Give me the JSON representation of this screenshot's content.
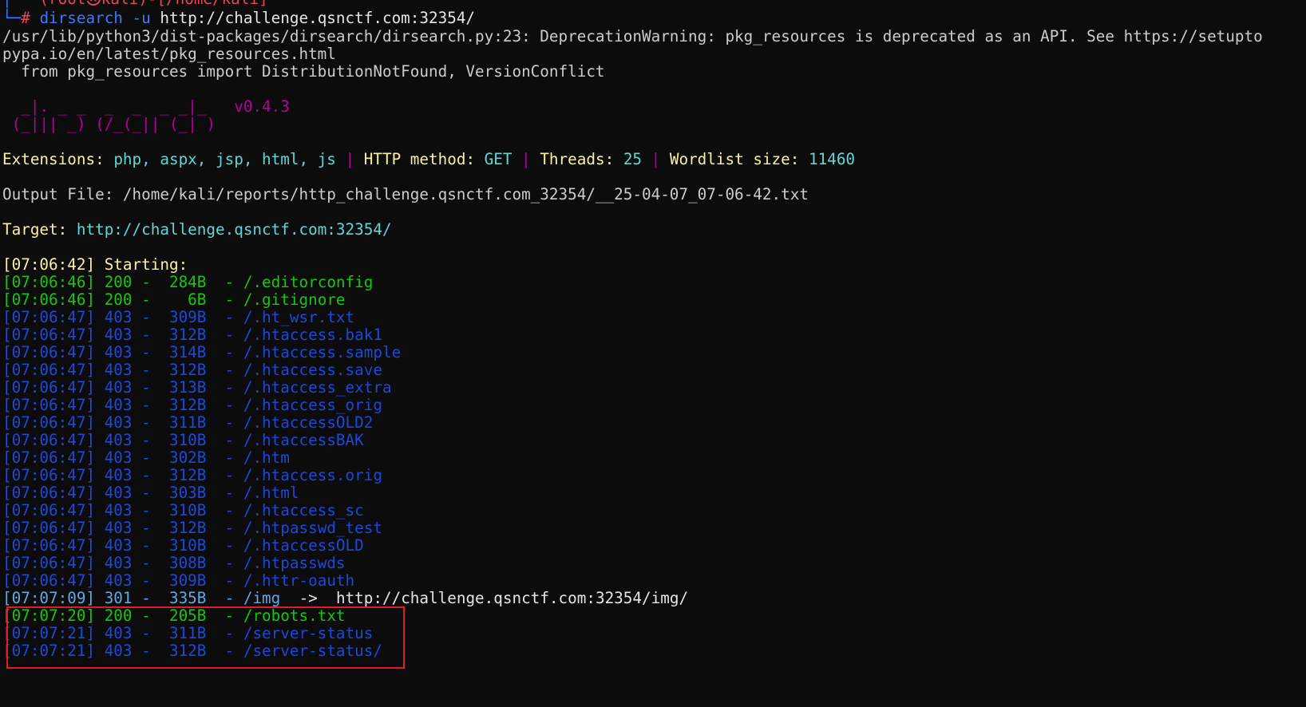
{
  "prompt": {
    "frame_top": "└─",
    "hash": "#",
    "root_fragment": "─(root㉿kali)-[/home/kali]",
    "command": "dirsearch",
    "flag": "-u",
    "url": "http://challenge.qsnctf.com:32354/"
  },
  "warning": {
    "line1": "/usr/lib/python3/dist-packages/dirsearch/dirsearch.py:23: DeprecationWarning: pkg_resources is deprecated as an API. See https://setupto",
    "line2": "pypa.io/en/latest/pkg_resources.html",
    "line3": "  from pkg_resources import DistributionNotFound, VersionConflict"
  },
  "banner": {
    "art1": "  _|. _ _  _  _  _ _|_   ",
    "art2": " (_||| _) (/_(_|| (_| )  ",
    "version": "v0.4.3"
  },
  "config": {
    "ext_label": "Extensions:",
    "ext_value": "php, aspx, jsp, html, js",
    "sep": "|",
    "method_label": "HTTP method:",
    "method_value": "GET",
    "threads_label": "Threads:",
    "threads_value": "25",
    "wordlist_label": "Wordlist size:",
    "wordlist_value": "11460"
  },
  "output_file": "Output File: /home/kali/reports/http_challenge.qsnctf.com_32354/__25-04-07_07-06-42.txt",
  "target": {
    "label": "Target:",
    "url": "http://challenge.qsnctf.com:32354/"
  },
  "start": {
    "time": "[07:06:42]",
    "label": "Starting:"
  },
  "results": [
    {
      "time": "[07:06:46]",
      "code": "200",
      "size": "284B",
      "path": "/.editorconfig",
      "color": "#16c60c"
    },
    {
      "time": "[07:06:46]",
      "code": "200",
      "size": "6B",
      "path": "/.gitignore",
      "color": "#16c60c"
    },
    {
      "time": "[07:06:47]",
      "code": "403",
      "size": "309B",
      "path": "/.ht_wsr.txt",
      "color": "#1f48d9"
    },
    {
      "time": "[07:06:47]",
      "code": "403",
      "size": "312B",
      "path": "/.htaccess.bak1",
      "color": "#1f48d9"
    },
    {
      "time": "[07:06:47]",
      "code": "403",
      "size": "314B",
      "path": "/.htaccess.sample",
      "color": "#1f48d9"
    },
    {
      "time": "[07:06:47]",
      "code": "403",
      "size": "312B",
      "path": "/.htaccess.save",
      "color": "#1f48d9"
    },
    {
      "time": "[07:06:47]",
      "code": "403",
      "size": "313B",
      "path": "/.htaccess_extra",
      "color": "#1f48d9"
    },
    {
      "time": "[07:06:47]",
      "code": "403",
      "size": "312B",
      "path": "/.htaccess_orig",
      "color": "#1f48d9"
    },
    {
      "time": "[07:06:47]",
      "code": "403",
      "size": "311B",
      "path": "/.htaccessOLD2",
      "color": "#1f48d9"
    },
    {
      "time": "[07:06:47]",
      "code": "403",
      "size": "310B",
      "path": "/.htaccessBAK",
      "color": "#1f48d9"
    },
    {
      "time": "[07:06:47]",
      "code": "403",
      "size": "302B",
      "path": "/.htm",
      "color": "#1f48d9"
    },
    {
      "time": "[07:06:47]",
      "code": "403",
      "size": "312B",
      "path": "/.htaccess.orig",
      "color": "#1f48d9"
    },
    {
      "time": "[07:06:47]",
      "code": "403",
      "size": "303B",
      "path": "/.html",
      "color": "#1f48d9"
    },
    {
      "time": "[07:06:47]",
      "code": "403",
      "size": "310B",
      "path": "/.htaccess_sc",
      "color": "#1f48d9"
    },
    {
      "time": "[07:06:47]",
      "code": "403",
      "size": "312B",
      "path": "/.htpasswd_test",
      "color": "#1f48d9"
    },
    {
      "time": "[07:06:47]",
      "code": "403",
      "size": "310B",
      "path": "/.htaccessOLD",
      "color": "#1f48d9"
    },
    {
      "time": "[07:06:47]",
      "code": "403",
      "size": "308B",
      "path": "/.htpasswds",
      "color": "#1f48d9"
    },
    {
      "time": "[07:06:47]",
      "code": "403",
      "size": "309B",
      "path": "/.httr-oauth",
      "color": "#1f48d9"
    },
    {
      "time": "[07:07:09]",
      "code": "301",
      "size": "335B",
      "path": "/img",
      "redirect": "http://challenge.qsnctf.com:32354/img/",
      "color": "#61a8e6"
    },
    {
      "time": "[07:07:20]",
      "code": "200",
      "size": "205B",
      "path": "/robots.txt",
      "color": "#16c60c"
    },
    {
      "time": "[07:07:21]",
      "code": "403",
      "size": "311B",
      "path": "/server-status",
      "color": "#1f48d9"
    },
    {
      "time": "[07:07:21]",
      "code": "403",
      "size": "312B",
      "path": "/server-status/",
      "color": "#1f48d9"
    }
  ],
  "arrow": "->"
}
